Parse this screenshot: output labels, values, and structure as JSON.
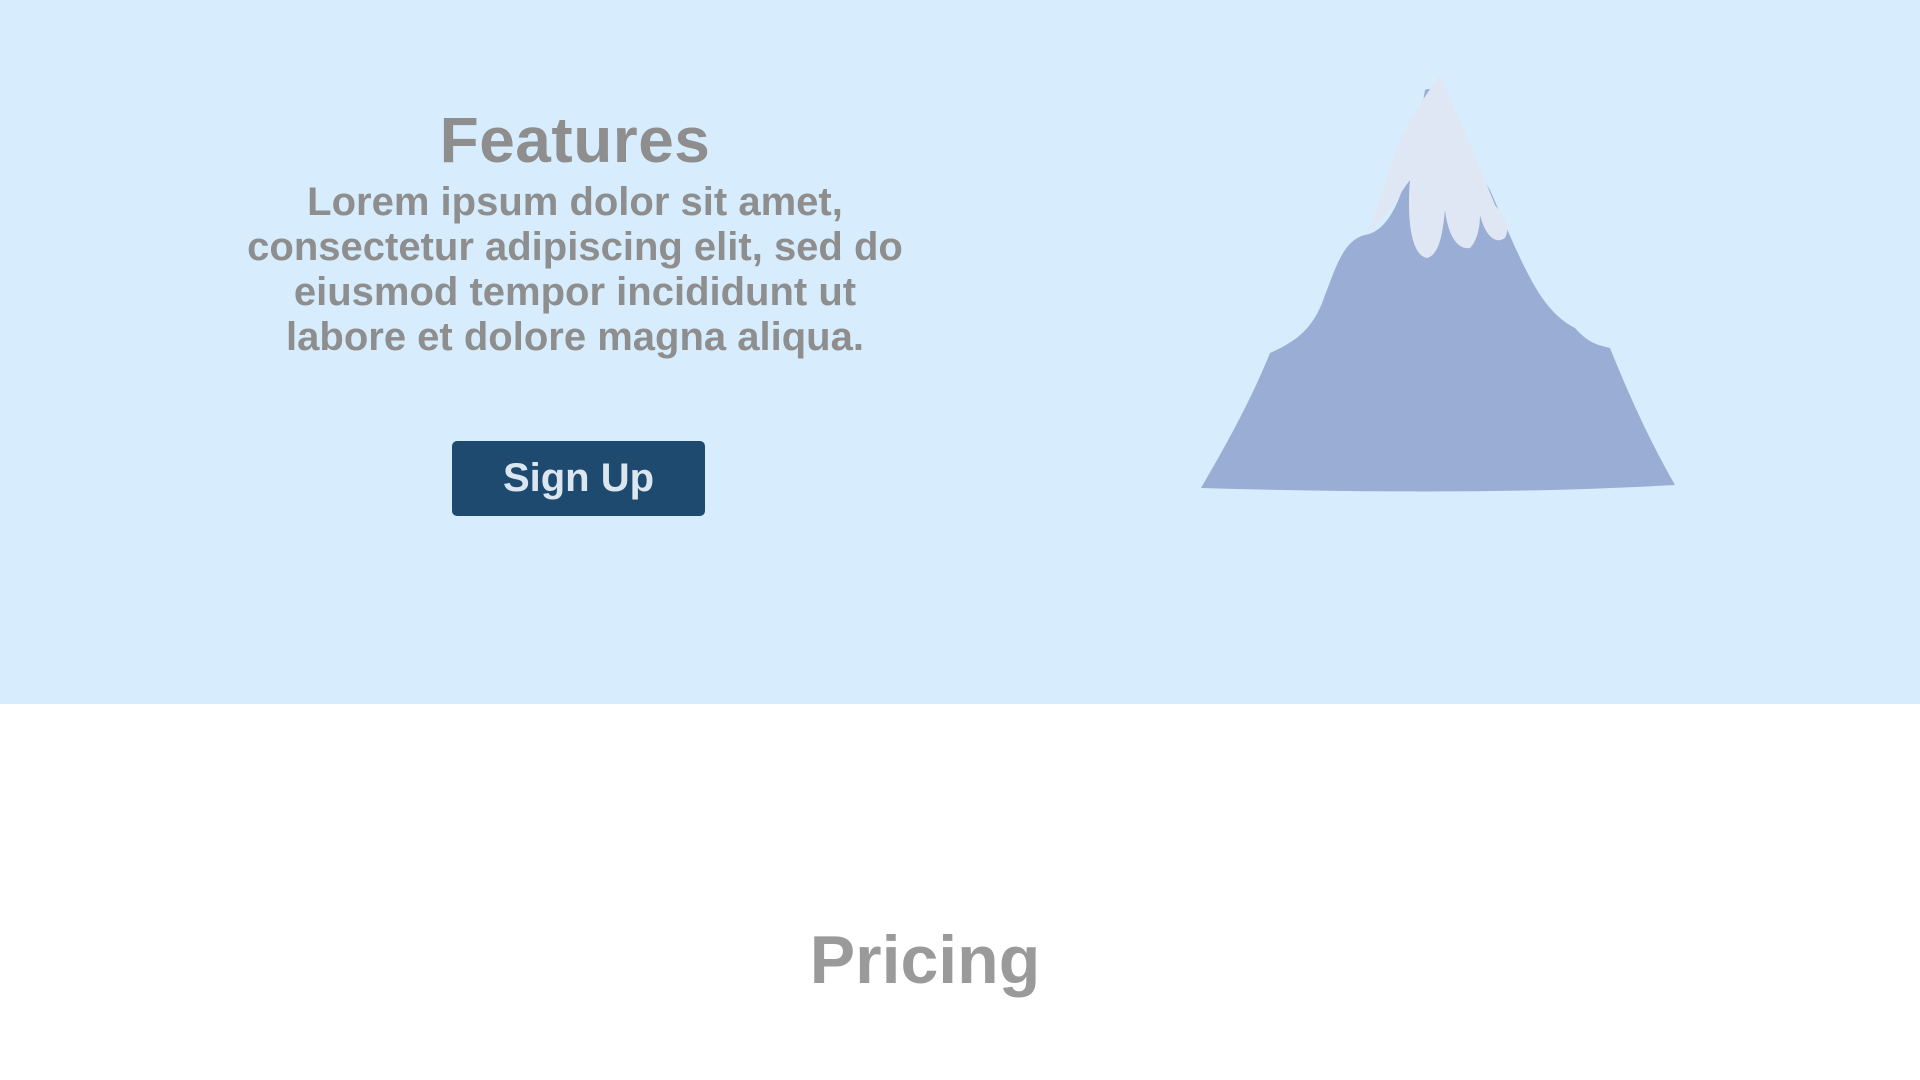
{
  "hero": {
    "title": "Features",
    "description": "Lorem ipsum dolor sit amet, consectetur adipiscing elit, sed do eiusmod tempor incididunt ut labore et dolore magna aliqua.",
    "button_label": "Sign Up",
    "illustration_icon": "mountain-icon",
    "background_color": "#d7edfd",
    "button_color": "#1f4a70"
  },
  "pricing": {
    "title": "Pricing"
  }
}
